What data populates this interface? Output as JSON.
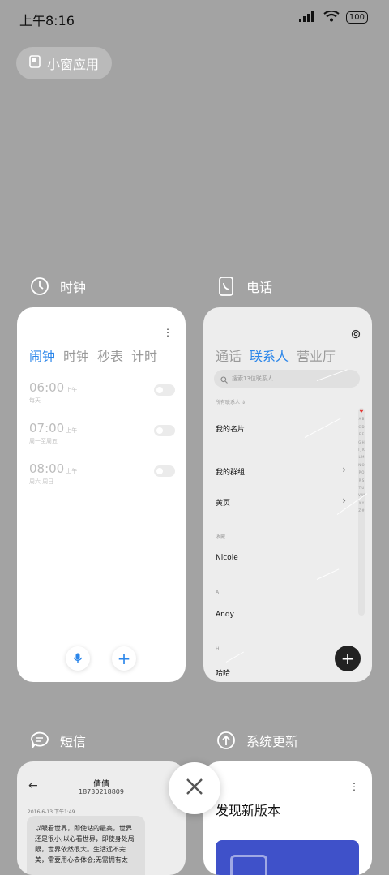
{
  "status_bar": {
    "time": "上午8:16",
    "battery": "100"
  },
  "floating_apps": {
    "label": "小窗应用"
  },
  "apps": {
    "clock": {
      "title": "时钟",
      "tabs": [
        "闹钟",
        "时钟",
        "秒表",
        "计时"
      ],
      "alarms": [
        {
          "time": "06:00",
          "ampm": "上午",
          "days": "每天"
        },
        {
          "time": "07:00",
          "ampm": "上午",
          "days": "周一至周五"
        },
        {
          "time": "08:00",
          "ampm": "上午",
          "days": "周六 周日"
        }
      ]
    },
    "phone": {
      "title": "电话",
      "tabs": [
        "通话",
        "联系人",
        "营业厅"
      ],
      "search_placeholder": "搜索13位联系人",
      "all_contacts": "所有联系人",
      "my_card": "我的名片",
      "my_groups": "我的群组",
      "yellow_pages": "黄页",
      "favorites_label": "收藏",
      "favorite_contact": "Nicole",
      "section_a": "A",
      "contact_a": "Andy",
      "section_h": "H",
      "contact_h": "哈哈",
      "index_letters": "A B C D E F G H I J K L M N O P Q R S T U V W X Y Z #"
    },
    "sms": {
      "title": "短信",
      "contact_name": "倩倩",
      "contact_number": "18730218809",
      "timestamp": "2016-6-13 下午1:49",
      "message": "以眼看世界，即使站的最高，世界还是很小;以心看世界，即使身处局限，世界依然很大。生活远不完美，需要用心去体会;无需拥有太"
    },
    "update": {
      "title": "系统更新",
      "headline": "发现新版本"
    }
  },
  "colors": {
    "accent": "#2b86ea",
    "background": "#a3a3a3"
  }
}
